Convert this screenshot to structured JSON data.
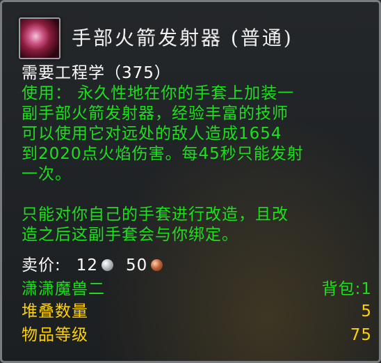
{
  "item": {
    "icon": "rocket-launcher-icon",
    "name": "手部火箭发射器 (普通)",
    "requirement": "需要工程学（375）",
    "description_lines": [
      "使用： 永久性地在你的手套上加装一",
      "副手部火箭发射器，经验丰富的技师",
      "可以使用它对远处的敌人造成1654",
      "到2020点火焰伤害。每45秒只能发射",
      "一次。",
      "",
      "只能对你自己的手套进行改造，且改",
      "造之后这副手套会与你绑定。"
    ]
  },
  "sell": {
    "label": "卖价:",
    "silver": "12",
    "copper": "50"
  },
  "info": {
    "source_left": "潇潇魔兽二",
    "source_right": "背包:1",
    "stack_label": "堆叠数量",
    "stack_value": "5",
    "level_label": "物品等级",
    "level_value": "75"
  },
  "colors": {
    "title": "#f0f0f0",
    "green_text": "#1ddf1d",
    "gold_text": "#ffd100",
    "border": "#7a7d80"
  }
}
